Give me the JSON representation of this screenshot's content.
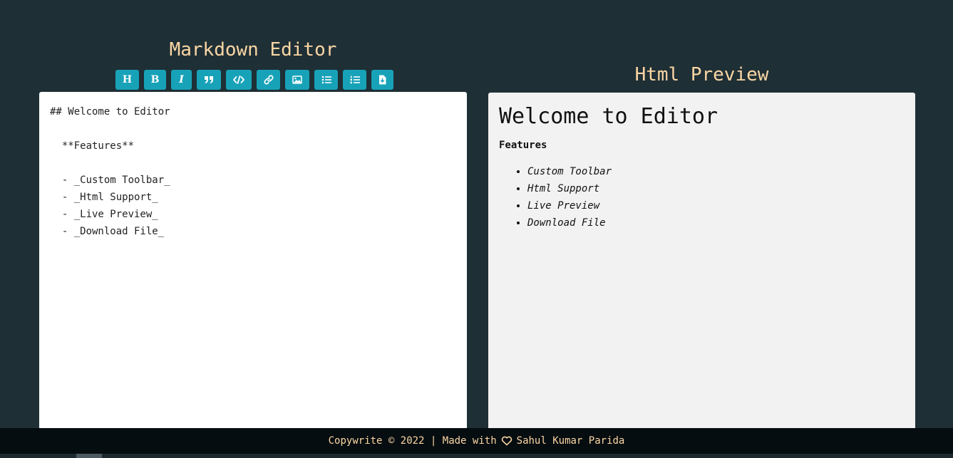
{
  "editor": {
    "title": "Markdown Editor",
    "content": "## Welcome to Editor\n\n  **Features**\n\n  - _Custom Toolbar_\n  - _Html Support_\n  - _Live Preview_\n  - _Download File_"
  },
  "toolbar": {
    "buttons": [
      {
        "name": "heading",
        "glyph": "H",
        "icon": "heading-icon"
      },
      {
        "name": "bold",
        "glyph": "B",
        "icon": "bold-icon"
      },
      {
        "name": "italic",
        "glyph": "I",
        "icon": "italic-icon"
      },
      {
        "name": "quote",
        "icon": "quote-icon"
      },
      {
        "name": "code",
        "icon": "code-icon"
      },
      {
        "name": "link",
        "icon": "link-icon"
      },
      {
        "name": "image",
        "icon": "image-icon"
      },
      {
        "name": "unordered-list",
        "icon": "unordered-list-icon"
      },
      {
        "name": "ordered-list",
        "icon": "ordered-list-icon"
      },
      {
        "name": "download",
        "icon": "download-file-icon"
      }
    ]
  },
  "preview": {
    "title": "Html Preview",
    "heading": "Welcome to Editor",
    "strong": "Features",
    "items": [
      "Custom Toolbar",
      "Html Support",
      "Live Preview",
      "Download File"
    ]
  },
  "footer": {
    "left": "Copywrite © 2022 | Made with",
    "icon": "heart-icon",
    "right": "Sahul Kumar Parida"
  },
  "colors": {
    "background": "#1f2f36",
    "accent": "#17a2b8",
    "title": "#fcd7a4",
    "footer_bg": "#060d10"
  }
}
